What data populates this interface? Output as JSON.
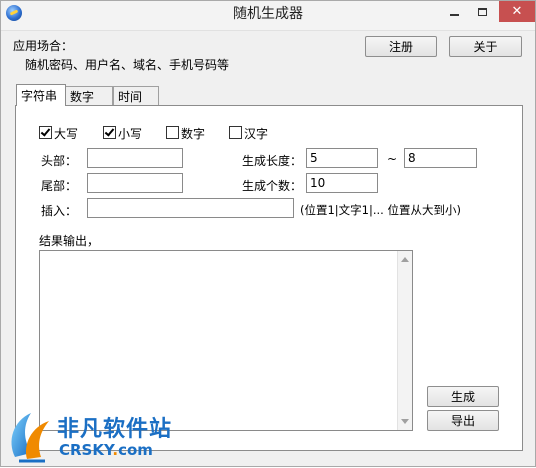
{
  "window": {
    "title": "随机生成器",
    "close_glyph": "✕"
  },
  "header": {
    "usage_label": "应用场合：",
    "usage_desc": "随机密码、用户名、域名、手机号码等",
    "register_button": "注册",
    "about_button": "关于"
  },
  "tabs": [
    {
      "label": "字符串",
      "active": true
    },
    {
      "label": "数字",
      "active": false
    },
    {
      "label": "时间",
      "active": false
    }
  ],
  "charset": {
    "uppercase": {
      "label": "大写",
      "checked": true
    },
    "lowercase": {
      "label": "小写",
      "checked": true
    },
    "digits": {
      "label": "数字",
      "checked": false
    },
    "chinese": {
      "label": "汉字",
      "checked": false
    }
  },
  "form": {
    "head_label": "头部：",
    "head_value": "",
    "tail_label": "尾部：",
    "tail_value": "",
    "insert_label": "插入：",
    "insert_value": "",
    "insert_hint": "(位置1|文字1|... 位置从大到小)",
    "length_label": "生成长度：",
    "length_min": "5",
    "length_sep": "~",
    "length_max": "8",
    "count_label": "生成个数：",
    "count_value": "10"
  },
  "output": {
    "label": "结果输出，",
    "value": ""
  },
  "actions": {
    "generate_button": "生成",
    "export_button": "导出"
  },
  "watermark": {
    "brand": "非凡软件站",
    "domain_main": "CRSKY",
    "domain_dot": ".",
    "domain_tld": "com"
  },
  "colors": {
    "watermark_blue": "#1b6fc4",
    "watermark_orange": "#f08a00",
    "close_red": "#c75050"
  }
}
